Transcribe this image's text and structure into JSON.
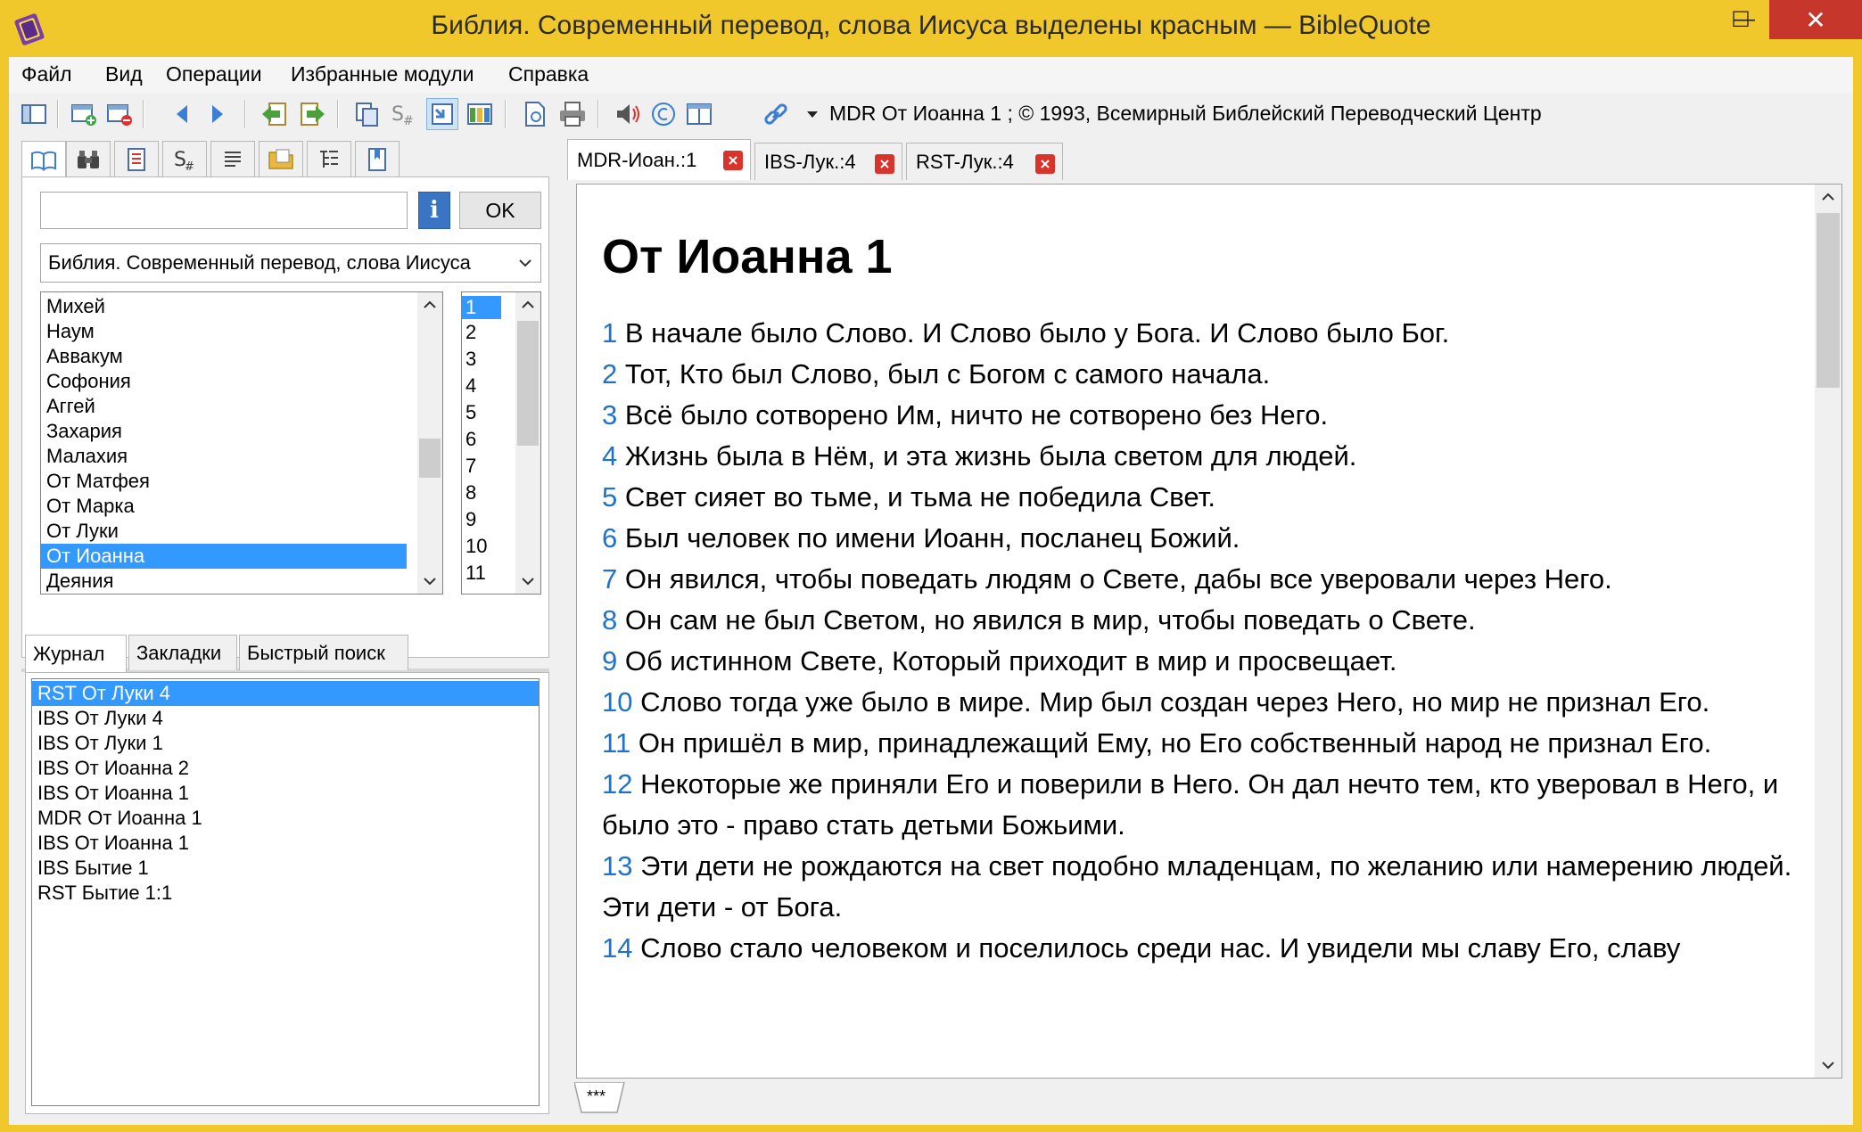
{
  "window": {
    "title": "Библия. Современный перевод, слова Иисуса выделены красным — BibleQuote",
    "minimize": "—",
    "maximize": "☐",
    "close": "✕"
  },
  "menu": [
    "Файл",
    "Вид",
    "Операции",
    "Избранные модули",
    "Справка"
  ],
  "toolbar": {
    "info_text": "MDR От Иоанна 1   ; © 1993, Всемирный Библейский Переводческий Центр"
  },
  "left_panel": {
    "search_value": "",
    "ok_label": "OK",
    "info_button": "i",
    "module_selected": "Библия. Современный перевод, слова Иисуса",
    "books": [
      "Михей",
      "Наум",
      "Аввакум",
      "Софония",
      "Аггей",
      "Захария",
      "Малахия",
      "От Матфея",
      "От Марка",
      "От Луки",
      "От Иоанна",
      "Деяния"
    ],
    "books_selected": "От Иоанна",
    "chapters": [
      "1",
      "2",
      "3",
      "4",
      "5",
      "6",
      "7",
      "8",
      "9",
      "10",
      "11"
    ],
    "chapters_selected": "1"
  },
  "bottom_tabs": [
    "Журнал",
    "Закладки",
    "Быстрый поиск"
  ],
  "history": [
    "RST От Луки 4",
    "IBS От Луки 4",
    "IBS От Луки 1",
    "IBS От Иоанна 2",
    "IBS От Иоанна 1",
    "MDR От Иоанна 1",
    "IBS От Иоанна 1",
    "IBS Бытие 1",
    "RST Бытие 1:1"
  ],
  "history_selected": "RST От Луки 4",
  "doc_tabs": [
    "MDR-Иоан.:1",
    "IBS-Лук.:4",
    "RST-Лук.:4"
  ],
  "document": {
    "title": "От Иоанна 1",
    "verses": [
      {
        "n": "1",
        "t": "В начале было Слово. И Слово было у Бога. И Слово было Бог."
      },
      {
        "n": "2",
        "t": "Тот, Кто был Слово, был с Богом с самого начала."
      },
      {
        "n": "3",
        "t": "Всё было сотворено Им, ничто не сотворено без Него."
      },
      {
        "n": "4",
        "t": "Жизнь была в Нём, и эта жизнь была светом для людей."
      },
      {
        "n": "5",
        "t": "Свет сияет во тьме, и тьма не победила Свет."
      },
      {
        "n": "6",
        "t": "Был человек по имени Иоанн, посланец Божий."
      },
      {
        "n": "7",
        "t": "Он явился, чтобы поведать людям о Свете, дабы все уверовали через Него."
      },
      {
        "n": "8",
        "t": "Он сам не был Светом, но явился в мир, чтобы поведать о Свете."
      },
      {
        "n": "9",
        "t": "Об истинном Свете, Который приходит в мир и просвещает."
      },
      {
        "n": "10",
        "t": "Слово тогда уже было в мире. Мир был создан через Него, но мир не признал Его."
      },
      {
        "n": "11",
        "t": "Он пришёл в мир, принадлежащий Ему, но Его собственный народ не признал Его."
      },
      {
        "n": "12",
        "t": "Некоторые же приняли Его и поверили в Него. Он дал нечто тем, кто уверовал в Него, и было это - право стать детьми Божьими."
      },
      {
        "n": "13",
        "t": "Эти дети не рождаются на свет подобно младенцам, по желанию или намерению людей. Эти дети - от Бога."
      },
      {
        "n": "14",
        "t": "Слово стало человеком и поселилось среди нас. И увидели мы славу Его, славу"
      }
    ]
  },
  "status_tab": "***",
  "colors": {
    "titlebar": "#f0c82c",
    "selection": "#3399ff",
    "verse_number": "#1e73c8",
    "close_red": "#d9342b"
  }
}
